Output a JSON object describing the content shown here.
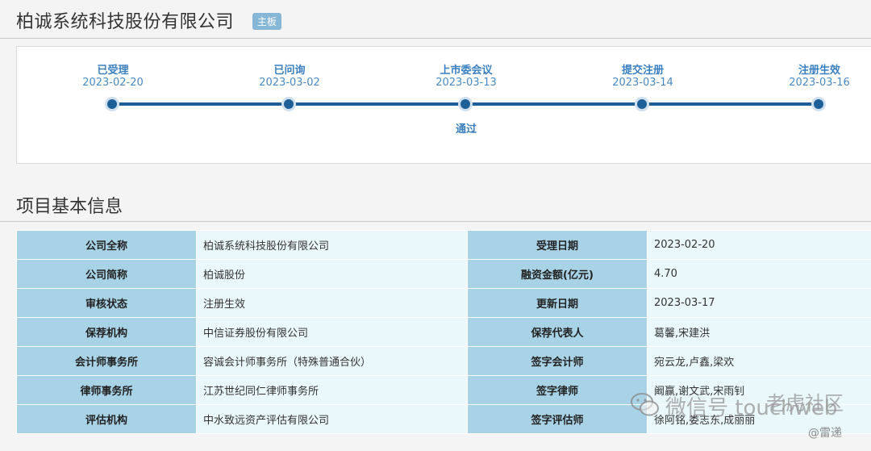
{
  "company": {
    "name": "柏诚系统科技股份有限公司",
    "board": "主板"
  },
  "timeline": {
    "steps": [
      {
        "label": "已受理",
        "date": "2023-02-20",
        "result": ""
      },
      {
        "label": "已问询",
        "date": "2023-03-02",
        "result": ""
      },
      {
        "label": "上市委会议",
        "date": "2023-03-13",
        "result": "通过"
      },
      {
        "label": "提交注册",
        "date": "2023-03-14",
        "result": ""
      },
      {
        "label": "注册生效",
        "date": "2023-03-16",
        "result": ""
      }
    ]
  },
  "section": {
    "title": "项目基本信息"
  },
  "info": {
    "rows": [
      {
        "l1": "公司全称",
        "v1": "柏诚系统科技股份有限公司",
        "l2": "受理日期",
        "v2": "2023-02-20"
      },
      {
        "l1": "公司简称",
        "v1": "柏诚股份",
        "l2": "融资金额(亿元)",
        "v2": "4.70"
      },
      {
        "l1": "审核状态",
        "v1": "注册生效",
        "l2": "更新日期",
        "v2": "2023-03-17"
      },
      {
        "l1": "保荐机构",
        "v1": "中信证券股份有限公司",
        "l2": "保荐代表人",
        "v2": "葛馨,宋建洪"
      },
      {
        "l1": "会计师事务所",
        "v1": "容诚会计师事务所（特殊普通合伙）",
        "l2": "签字会计师",
        "v2": "宛云龙,卢鑫,梁欢"
      },
      {
        "l1": "律师事务所",
        "v1": "江苏世纪同仁律师事务所",
        "l2": "签字律师",
        "v2": "阚赢,谢文武,宋雨钊"
      },
      {
        "l1": "评估机构",
        "v1": "中水致远资产评估有限公司",
        "l2": "签字评估师",
        "v2": "徐阿铭,娄志东,成丽丽"
      }
    ]
  },
  "watermark": {
    "text": "微信号 touchweb",
    "overlay": "老虎社区",
    "sub": "@雷递"
  }
}
